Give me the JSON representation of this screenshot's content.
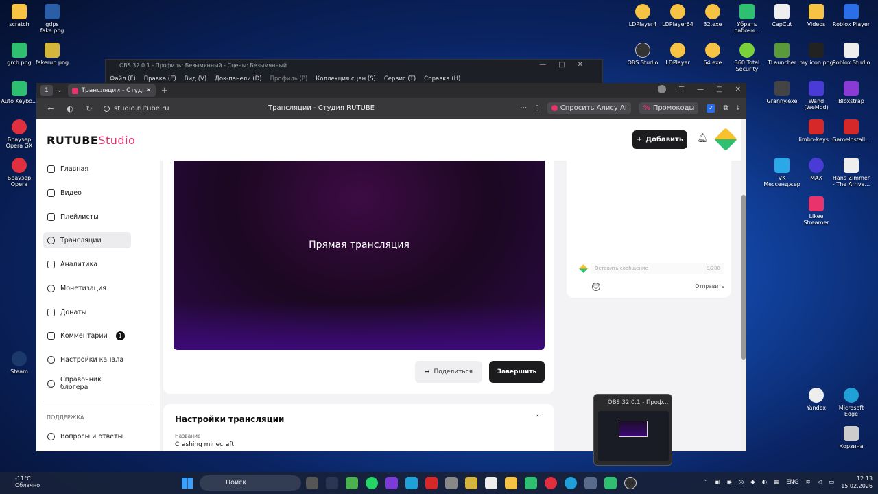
{
  "desktop": {
    "icons": [
      {
        "label": "scratch",
        "color": "#f6c344"
      },
      {
        "label": "gdps fake.png",
        "color": "#2a5fa8"
      },
      {
        "label": "grcb.png",
        "color": "#2fbf71"
      },
      {
        "label": "fakerup.png",
        "color": "#d4b63c"
      },
      {
        "label": "Auto Keybo...",
        "color": "#2fbf71"
      },
      {
        "label": "Браузер Opera GX",
        "color": "#e0303f"
      },
      {
        "label": "Браузер Opera",
        "color": "#e0303f"
      },
      {
        "label": "Steam",
        "color": "#1b3a6b"
      },
      {
        "label": "LDPlayer4",
        "color": "#f6c344"
      },
      {
        "label": "LDPlayer64",
        "color": "#f6c344"
      },
      {
        "label": "32.exe",
        "color": "#f6c344"
      },
      {
        "label": "Убрать рабочи...",
        "color": "#2fbf71"
      },
      {
        "label": "CapCut",
        "color": "#eeeeee"
      },
      {
        "label": "Videos",
        "color": "#f6c344"
      },
      {
        "label": "Roblox Player",
        "color": "#2a6fe8"
      },
      {
        "label": "OBS Studio",
        "color": "#333333"
      },
      {
        "label": "LDPlayer",
        "color": "#f6c344"
      },
      {
        "label": "64.exe",
        "color": "#f6c344"
      },
      {
        "label": "360 Total Security",
        "color": "#7bd13a"
      },
      {
        "label": "TLauncher",
        "color": "#5a9a3a"
      },
      {
        "label": "my icon.png",
        "color": "#222222"
      },
      {
        "label": "Roblox Studio",
        "color": "#eeeeee"
      },
      {
        "label": "Granny.exe",
        "color": "#444444"
      },
      {
        "label": "Wand (WeMod)",
        "color": "#4b3bd6"
      },
      {
        "label": "Bloxstrap",
        "color": "#8a3bd6"
      },
      {
        "label": "limbo-keys...",
        "color": "#d62828"
      },
      {
        "label": "GameInstall...",
        "color": "#d62828"
      },
      {
        "label": "VK Мессенджер",
        "color": "#2aa8e8"
      },
      {
        "label": "MAX",
        "color": "#4b3bd6"
      },
      {
        "label": "Hans Zimmer - The Arriva...",
        "color": "#eeeeee"
      },
      {
        "label": "Likee Streamer",
        "color": "#e8336d"
      },
      {
        "label": "Yandex",
        "color": "#eeeeee"
      },
      {
        "label": "Microsoft Edge",
        "color": "#1fa0d6"
      },
      {
        "label": "Корзина",
        "color": "#cccccc"
      }
    ]
  },
  "obs": {
    "title": "OBS 32.0.1 - Профиль: Безымянный - Сцены: Безымянный",
    "menu": [
      "Файл (F)",
      "Правка (E)",
      "Вид (V)",
      "Док-панели (D)",
      "Профиль (P)",
      "Коллекция сцен (S)",
      "Сервис (T)",
      "Справка (H)"
    ]
  },
  "browser": {
    "tab_title": "Трансляции - Студия RUTUBE",
    "url": "studio.rutube.ru",
    "page_title": "Трансляции - Студия RUTUBE",
    "alice_label": "Спросить Алису AI",
    "promo_label": "Промокоды",
    "tab_count": "1"
  },
  "app": {
    "logo": "RUTUBE",
    "logo_suffix": "Studio",
    "add_label": "Добавить",
    "sidebar": [
      {
        "label": "Главная",
        "icon": "home-icon"
      },
      {
        "label": "Видео",
        "icon": "video-icon"
      },
      {
        "label": "Плейлисты",
        "icon": "playlist-icon"
      },
      {
        "label": "Трансляции",
        "icon": "broadcast-icon"
      },
      {
        "label": "Аналитика",
        "icon": "analytics-icon"
      },
      {
        "label": "Монетизация",
        "icon": "monetization-icon"
      },
      {
        "label": "Донаты",
        "icon": "donate-icon"
      },
      {
        "label": "Комментарии",
        "icon": "comments-icon",
        "badge": "1"
      },
      {
        "label": "Настройки канала",
        "icon": "settings-icon"
      },
      {
        "label": "Справочник блогера",
        "icon": "guide-icon"
      }
    ],
    "support_section": "ПОДДЕРЖКА",
    "faq_label": "Вопросы и ответы",
    "video_label": "Прямая трансляция",
    "share_label": "Поделиться",
    "end_label": "Завершить",
    "settings_title": "Настройки трансляции",
    "name_label": "Название",
    "name_value": "Crashing minecraft",
    "chat": {
      "placeholder": "Оставить сообщение",
      "counter": "0/200",
      "send_label": "Отправить"
    }
  },
  "preview": {
    "title": "OBS 32.0.1 - Проф..."
  },
  "taskbar": {
    "temp": "-11°C",
    "weather": "Облачно",
    "search": "Поиск",
    "lang": "ENG",
    "time": "12:13",
    "date": "15.02.2026"
  }
}
